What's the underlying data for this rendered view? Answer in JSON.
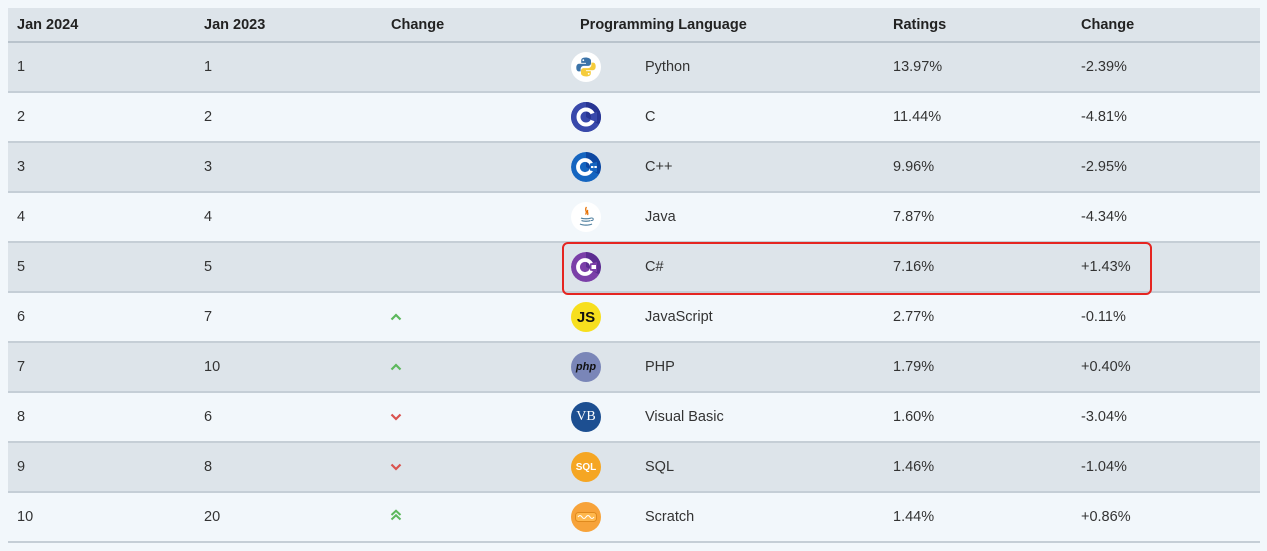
{
  "headers": [
    "Jan 2024",
    "Jan 2023",
    "Change",
    "Programming Language",
    "Ratings",
    "Change"
  ],
  "rows": [
    {
      "rank_2024": "1",
      "rank_2023": "1",
      "trend": "none",
      "icon": "python-logo-icon",
      "language": "Python",
      "rating": "13.97%",
      "change": "-2.39%"
    },
    {
      "rank_2024": "2",
      "rank_2023": "2",
      "trend": "none",
      "icon": "c-logo-icon",
      "language": "C",
      "rating": "11.44%",
      "change": "-4.81%"
    },
    {
      "rank_2024": "3",
      "rank_2023": "3",
      "trend": "none",
      "icon": "cpp-logo-icon",
      "language": "C++",
      "rating": "9.96%",
      "change": "-2.95%"
    },
    {
      "rank_2024": "4",
      "rank_2023": "4",
      "trend": "none",
      "icon": "java-logo-icon",
      "language": "Java",
      "rating": "7.87%",
      "change": "-4.34%"
    },
    {
      "rank_2024": "5",
      "rank_2023": "5",
      "trend": "none",
      "icon": "csharp-logo-icon",
      "language": "C#",
      "rating": "7.16%",
      "change": "+1.43%"
    },
    {
      "rank_2024": "6",
      "rank_2023": "7",
      "trend": "up",
      "icon": "javascript-logo-icon",
      "language": "JavaScript",
      "rating": "2.77%",
      "change": "-0.11%"
    },
    {
      "rank_2024": "7",
      "rank_2023": "10",
      "trend": "up",
      "icon": "php-logo-icon",
      "language": "PHP",
      "rating": "1.79%",
      "change": "+0.40%"
    },
    {
      "rank_2024": "8",
      "rank_2023": "6",
      "trend": "down",
      "icon": "visual-basic-logo-icon",
      "language": "Visual Basic",
      "rating": "1.60%",
      "change": "-3.04%"
    },
    {
      "rank_2024": "9",
      "rank_2023": "8",
      "trend": "down",
      "icon": "sql-logo-icon",
      "language": "SQL",
      "rating": "1.46%",
      "change": "-1.04%"
    },
    {
      "rank_2024": "10",
      "rank_2023": "20",
      "trend": "double-up",
      "icon": "scratch-logo-icon",
      "language": "Scratch",
      "rating": "1.44%",
      "change": "+0.86%"
    }
  ],
  "logo_text": {
    "javascript": "JS",
    "php": "php",
    "visual_basic": "VB",
    "sql": "SQL"
  },
  "highlighted_row": 4,
  "colors": {
    "up_arrow": "#5cb85c",
    "down_arrow": "#d9534f",
    "highlight_border": "#e52521",
    "row_odd": "#dde4ea",
    "row_even": "#f2f7fb"
  }
}
